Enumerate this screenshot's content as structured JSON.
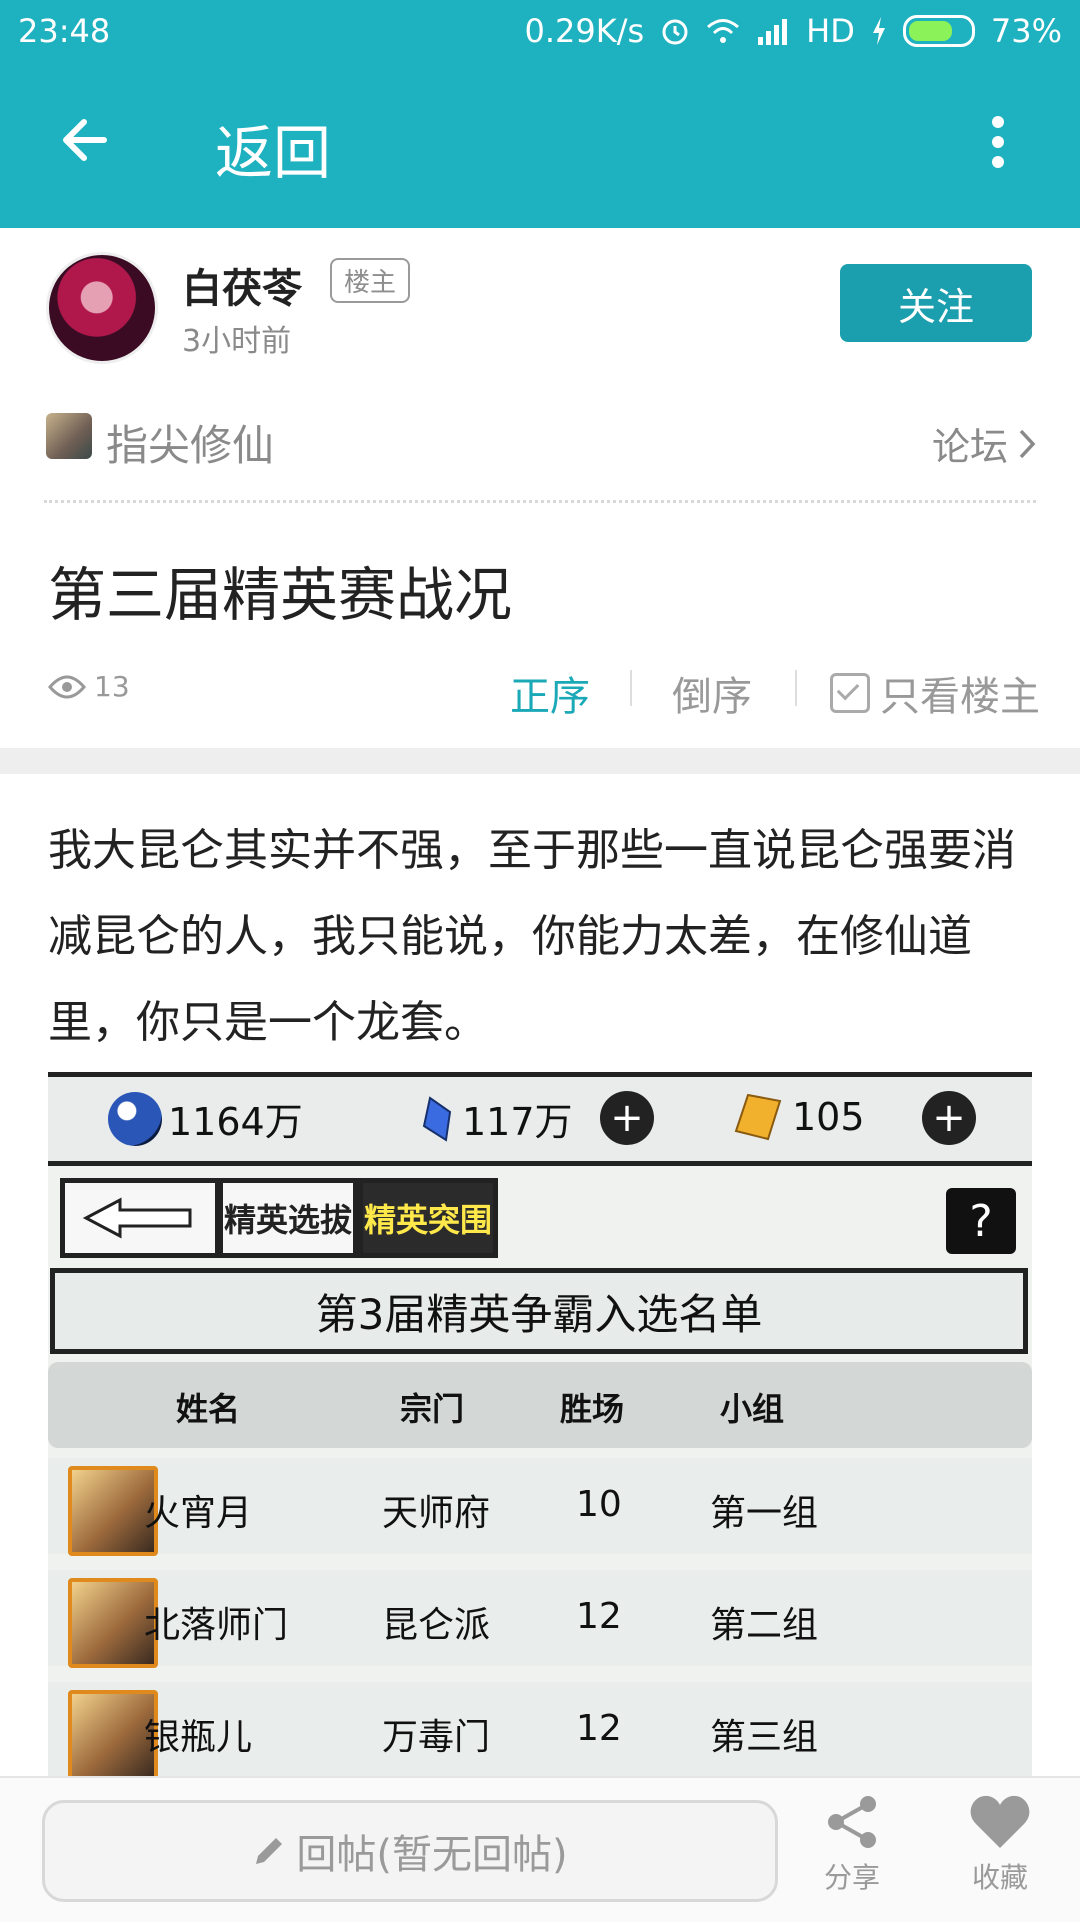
{
  "status": {
    "time": "23:48",
    "speed": "0.29K/s",
    "network": "HD",
    "battery": "73%"
  },
  "toolbar": {
    "back_label": "返回"
  },
  "author": {
    "name": "白茯苓",
    "badge": "楼主",
    "time": "3小时前",
    "follow_label": "关注"
  },
  "forum": {
    "name": "指尖修仙",
    "link_label": "论坛"
  },
  "post": {
    "title": "第三届精英赛战况",
    "views": "13",
    "sort_asc": "正序",
    "sort_desc": "倒序",
    "owner_only": "只看楼主",
    "body": "我大昆仑其实并不强，至于那些一直说昆仑强要消减昆仑的人，我只能说，你能力太差，在修仙道里，你只是一个龙套。"
  },
  "game": {
    "resources": [
      "1164万",
      "117万",
      "105"
    ],
    "tabs": [
      "精英选拔",
      "精英突围"
    ],
    "help": "?",
    "banner": "第3届精英争霸入选名单",
    "headers": [
      "姓名",
      "宗门",
      "胜场",
      "小组"
    ],
    "rows": [
      {
        "name": "火宵月",
        "sect": "天师府",
        "wins": "10",
        "group": "第一组"
      },
      {
        "name": "北落师门",
        "sect": "昆仑派",
        "wins": "12",
        "group": "第二组"
      },
      {
        "name": "银瓶儿",
        "sect": "万毒门",
        "wins": "12",
        "group": "第三组"
      }
    ]
  },
  "bottom": {
    "reply_placeholder": "回帖(暂无回帖)",
    "share": "分享",
    "favorite": "收藏"
  },
  "colors": {
    "accent": "#1eb1bf",
    "follow": "#1b9eae"
  }
}
